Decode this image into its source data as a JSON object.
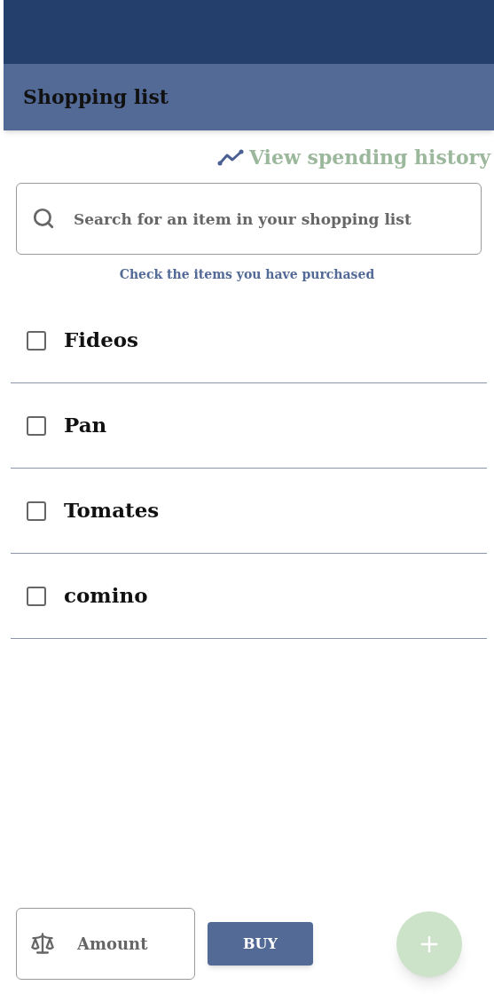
{
  "header": {
    "title": "Shopping list"
  },
  "history_link": {
    "label": "View spending history"
  },
  "search": {
    "placeholder": "Search for an item in your shopping list"
  },
  "hint": "Check the items you have purchased",
  "items": [
    {
      "name": "Fideos",
      "checked": false
    },
    {
      "name": "Pan",
      "checked": false
    },
    {
      "name": "Tomates",
      "checked": false
    },
    {
      "name": "comino",
      "checked": false
    }
  ],
  "amount": {
    "placeholder": "Amount"
  },
  "buy_button": {
    "label": "BUY"
  }
}
